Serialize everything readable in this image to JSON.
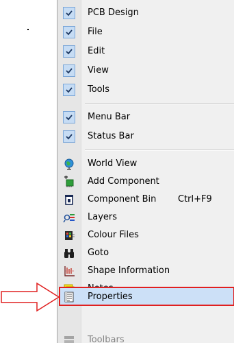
{
  "menu": {
    "checked_items": [
      {
        "label": "PCB Design",
        "checked": true
      },
      {
        "label": "File",
        "checked": true
      },
      {
        "label": "Edit",
        "checked": true
      },
      {
        "label": "View",
        "checked": true
      },
      {
        "label": "Tools",
        "checked": true
      }
    ],
    "bars": [
      {
        "label": "Menu Bar",
        "checked": true
      },
      {
        "label": "Status Bar",
        "checked": true
      }
    ],
    "windows": [
      {
        "label": "World View",
        "icon": "globe-icon"
      },
      {
        "label": "Add Component",
        "icon": "add-component-icon"
      },
      {
        "label": "Component Bin",
        "icon": "component-bin-icon",
        "shortcut": "Ctrl+F9"
      },
      {
        "label": "Layers",
        "icon": "layers-icon"
      },
      {
        "label": "Colour Files",
        "icon": "colour-files-icon"
      },
      {
        "label": "Goto",
        "icon": "binoculars-icon"
      },
      {
        "label": "Shape Information",
        "icon": "shape-information-icon"
      },
      {
        "label": "Notes",
        "icon": "notes-icon"
      },
      {
        "label": "Properties",
        "icon": "properties-icon",
        "highlighted": true
      },
      {
        "label": "Toolbars",
        "icon": "toolbars-icon",
        "partially_visible": true
      }
    ]
  },
  "colors": {
    "highlight_border": "#e02020",
    "highlight_fill": "#cce0f7",
    "arrow_outline": "#e02020",
    "checkbox_fill": "#c6dcf4"
  }
}
